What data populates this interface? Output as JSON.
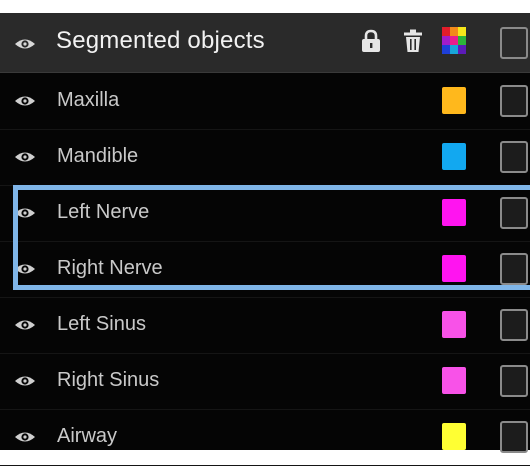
{
  "panel": {
    "title": "Segmented objects",
    "header_icons": [
      "eye-icon",
      "lock-icon",
      "trash-icon",
      "color-palette-icon"
    ]
  },
  "objects": [
    {
      "label": "Maxilla",
      "color": "#FFB81C",
      "visible": true,
      "selected": false
    },
    {
      "label": "Mandible",
      "color": "#12A8F0",
      "visible": true,
      "selected": false
    },
    {
      "label": "Left Nerve",
      "color": "#FF14F0",
      "visible": true,
      "selected": true
    },
    {
      "label": "Right Nerve",
      "color": "#FF14F0",
      "visible": true,
      "selected": true
    },
    {
      "label": "Left Sinus",
      "color": "#F852E8",
      "visible": true,
      "selected": false
    },
    {
      "label": "Right Sinus",
      "color": "#F852E8",
      "visible": true,
      "selected": false
    },
    {
      "label": "Airway",
      "color": "#FFFF33",
      "visible": true,
      "selected": false
    }
  ],
  "colors": {
    "header_bg": "#2A2A2A",
    "panel_bg": "#050505",
    "selection_border": "#7FB5E8"
  }
}
